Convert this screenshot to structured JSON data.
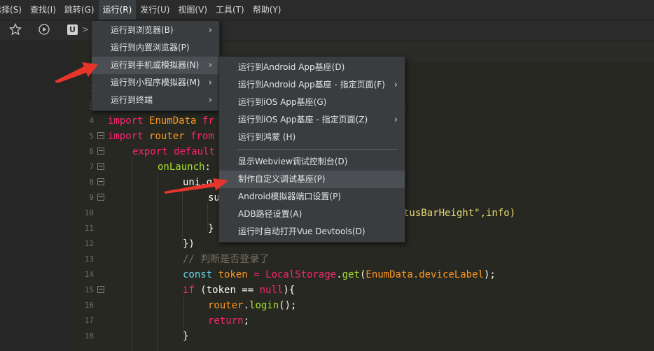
{
  "menubar": {
    "items": [
      "选择(S)",
      "查找(I)",
      "跳转(G)",
      "运行(R)",
      "发行(U)",
      "视图(V)",
      "工具(T)",
      "帮助(Y)"
    ],
    "active_index": 3
  },
  "toolbar": {
    "star_icon": "star-icon",
    "play_icon": "play-circle-icon",
    "u_label": "U",
    "arrow_label": ">"
  },
  "run_menu": {
    "items": [
      {
        "label": "运行到浏览器(B)",
        "submenu": true
      },
      {
        "label": "运行到内置浏览器(P)",
        "submenu": false
      },
      {
        "label": "运行到手机或模拟器(N)",
        "submenu": true
      },
      {
        "label": "运行到小程序模拟器(M)",
        "submenu": true
      },
      {
        "label": "运行到终端",
        "submenu": true
      }
    ],
    "highlighted": 2
  },
  "device_submenu": {
    "items": [
      {
        "label": "运行到Android App基座(D)",
        "submenu": false
      },
      {
        "label": "运行到Android App基座 - 指定页面(F)",
        "submenu": true
      },
      {
        "label": "运行到iOS App基座(G)",
        "submenu": false
      },
      {
        "label": "运行到iOS App基座 - 指定页面(Z)",
        "submenu": true
      },
      {
        "label": "运行到鸿蒙 (H)",
        "submenu": false
      },
      {
        "label": "显示Webview调试控制台(D)",
        "submenu": false
      },
      {
        "label": "制作自定义调试基座(P)",
        "submenu": false
      },
      {
        "label": "Android模拟器端口设置(P)",
        "submenu": false
      },
      {
        "label": "ADB路径设置(A)",
        "submenu": false
      },
      {
        "label": "运行时自动打开Vue Devtools(D)",
        "submenu": false
      }
    ],
    "highlighted": 6
  },
  "editor": {
    "line_numbers": [
      "1",
      "2",
      "3",
      "4",
      "5",
      "6",
      "7",
      "8",
      "9",
      "10",
      "11",
      "12",
      "13",
      "14",
      "15",
      "16",
      "17",
      "18"
    ],
    "line3_tail": ";",
    "line4": {
      "kw": "import",
      "name": "EnumData",
      "rest": "fr"
    },
    "line5": {
      "kw": "import",
      "name": "router",
      "rest": "from"
    },
    "line6": {
      "kw": "export",
      "rest": "default"
    },
    "line7": {
      "name": "onLaunch",
      "rest": ":"
    },
    "line8": {
      "name": "uni.g"
    },
    "line9": {
      "name": "su",
      "tail": "tusBarHeight\",info)"
    },
    "line11": "}",
    "line12": "})",
    "line13": "// 判断是否登录了",
    "line14": {
      "kw": "const",
      "name": "token",
      "op": "=",
      "obj": "LocalStorage",
      "fn": "get",
      "arg": "EnumData.deviceLabel",
      "end": ");"
    },
    "line15": {
      "kw": "if",
      "open": "(token ==",
      "nl": "null",
      "close": "){"
    },
    "line16": {
      "obj": "router",
      "fn": "login",
      "end": "();"
    },
    "line17": {
      "kw": "return",
      "end": ";"
    },
    "line18": "}"
  },
  "colors": {
    "arrow": "#e8352a",
    "background": "#272822",
    "menu": "#3a3d40",
    "highlight": "#4b4f53"
  }
}
